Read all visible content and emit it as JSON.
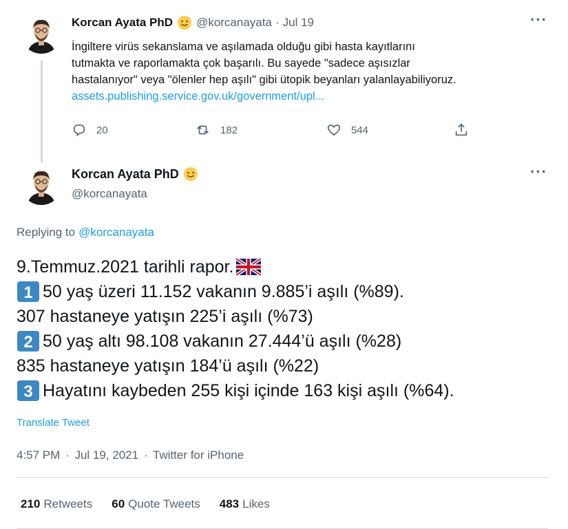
{
  "first_tweet": {
    "name": "Korcan Ayata PhD",
    "handle": "@korcanayata",
    "separator": "·",
    "date": "Jul 19",
    "lines": [
      "İngiltere virüs sekanslama ve aşılamada olduğu gibi hasta kayıtlarını",
      "tutmakta ve raporlamakta çok başarılı. Bu sayede \"sadece aşısızlar",
      "hastalanıyor\" veya \"ölenler hep aşılı\" gibi ütopik beyanları yalanlayabiliyoruz."
    ],
    "link": "assets.publishing.service.gov.uk/government/upl...",
    "replies": "20",
    "retweets": "182",
    "likes": "544"
  },
  "main_tweet": {
    "name": "Korcan Ayata PhD",
    "handle": "@korcanayata",
    "replying_label": "Replying to",
    "replying_handle": "@korcanayata",
    "lines": [
      "9.Temmuz.2021 tarihli rapor.",
      "50 yaş üzeri 11.152 vakanın 9.885’i aşılı (%89).",
      "307 hastaneye yatışın 225’i aşılı (%73)",
      "50 yaş altı 98.108 vakanın 27.444’ü aşılı (%28)",
      "835 hastaneye yatışın 184’ü aşılı (%22)",
      "Hayatını kaybeden 255 kişi içinde 163 kişi aşılı (%64)."
    ],
    "keycaps": [
      "1",
      "2",
      "3"
    ],
    "translate": "Translate Tweet",
    "time": "4:57 PM",
    "separator": "·",
    "date": "Jul 19, 2021",
    "source": "Twitter for iPhone",
    "stats": {
      "retweets_count": "210",
      "retweets_label": "Retweets",
      "quotes_count": "60",
      "quotes_label": "Quote Tweets",
      "likes_count": "483",
      "likes_label": "Likes"
    }
  },
  "icons": {
    "more": "more-icon",
    "reply": "reply-icon",
    "retweet": "retweet-icon",
    "like": "heart-icon",
    "share": "share-icon",
    "emoji": "smiley-emoji",
    "flag": "uk-flag-emoji"
  },
  "colors": {
    "link": "#1d9bf0",
    "muted": "#536471",
    "text": "#0f1419",
    "keycap": "#3b88c3"
  }
}
